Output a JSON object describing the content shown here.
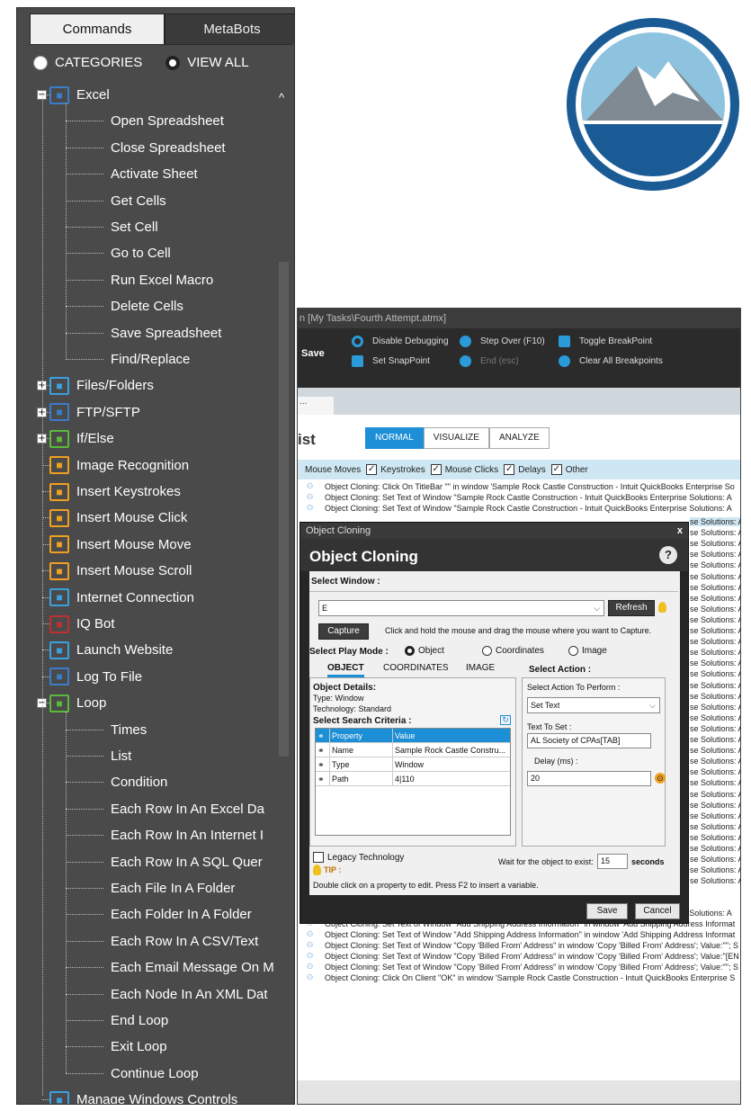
{
  "tabs": {
    "commands": "Commands",
    "metabots": "MetaBots"
  },
  "view": {
    "categories": "CATEGORIES",
    "view_all": "VIEW ALL",
    "selected": "view_all"
  },
  "tree": [
    {
      "label": "Excel",
      "icon": "excel-icon",
      "color": "#3a7dc9",
      "level": 0,
      "expander": "−"
    },
    {
      "label": "Open Spreadsheet",
      "level": 1
    },
    {
      "label": "Close Spreadsheet",
      "level": 1
    },
    {
      "label": "Activate Sheet",
      "level": 1
    },
    {
      "label": "Get Cells",
      "level": 1
    },
    {
      "label": "Set Cell",
      "level": 1
    },
    {
      "label": "Go to Cell",
      "level": 1
    },
    {
      "label": "Run Excel Macro",
      "level": 1
    },
    {
      "label": "Delete Cells",
      "level": 1
    },
    {
      "label": "Save Spreadsheet",
      "level": 1
    },
    {
      "label": "Find/Replace",
      "level": 1
    },
    {
      "label": "Files/Folders",
      "icon": "folder-icon",
      "color": "#3aa0e0",
      "level": 0,
      "expander": "+"
    },
    {
      "label": "FTP/SFTP",
      "icon": "ftp-icon",
      "color": "#3a7dc9",
      "level": 0,
      "expander": "+"
    },
    {
      "label": "If/Else",
      "icon": "if-else-icon",
      "color": "#5aba3a",
      "level": 0,
      "expander": "+"
    },
    {
      "label": "Image Recognition",
      "icon": "image-recognition-icon",
      "color": "#f0a020",
      "level": 0
    },
    {
      "label": "Insert Keystrokes",
      "icon": "keystrokes-icon",
      "color": "#f0a020",
      "level": 0
    },
    {
      "label": "Insert Mouse Click",
      "icon": "mouse-click-icon",
      "color": "#f0a020",
      "level": 0
    },
    {
      "label": "Insert Mouse Move",
      "icon": "mouse-move-icon",
      "color": "#f0a020",
      "level": 0
    },
    {
      "label": "Insert Mouse Scroll",
      "icon": "mouse-scroll-icon",
      "color": "#f0a020",
      "level": 0
    },
    {
      "label": "Internet Connection",
      "icon": "globe-icon",
      "color": "#3aa0e0",
      "level": 0
    },
    {
      "label": "IQ Bot",
      "icon": "iq-bot-icon",
      "color": "#c03030",
      "level": 0
    },
    {
      "label": "Launch Website",
      "icon": "launch-website-icon",
      "color": "#3aa0e0",
      "level": 0
    },
    {
      "label": "Log To File",
      "icon": "log-file-icon",
      "color": "#3a7dc9",
      "level": 0
    },
    {
      "label": "Loop",
      "icon": "loop-icon",
      "color": "#5aba3a",
      "level": 0,
      "expander": "−"
    },
    {
      "label": "Times",
      "level": 1
    },
    {
      "label": "List",
      "level": 1
    },
    {
      "label": "Condition",
      "level": 1
    },
    {
      "label": "Each Row In An Excel Da",
      "level": 1
    },
    {
      "label": "Each Row In An Internet I",
      "level": 1
    },
    {
      "label": "Each Row In A SQL Quer",
      "level": 1
    },
    {
      "label": "Each File In A Folder",
      "level": 1
    },
    {
      "label": "Each Folder In A Folder",
      "level": 1
    },
    {
      "label": "Each Row In A CSV/Text",
      "level": 1
    },
    {
      "label": "Each Email Message On M",
      "level": 1
    },
    {
      "label": "Each Node In An XML Dat",
      "level": 1
    },
    {
      "label": "End Loop",
      "level": 1
    },
    {
      "label": "Exit Loop",
      "level": 1
    },
    {
      "label": "Continue Loop",
      "level": 1
    },
    {
      "label": "Manage Windows Controls",
      "icon": "windows-controls-icon",
      "color": "#3aa0e0",
      "level": 0
    }
  ],
  "editor": {
    "window_title": "n [My Tasks\\Fourth Attempt.atmx]",
    "save": "Save",
    "toolbar": [
      {
        "label": "Disable Debugging",
        "icon": "debug-icon",
        "color": "#2a9ad8"
      },
      {
        "label": "Step Over (F10)",
        "icon": "step-over-icon",
        "color": "#2a9ad8"
      },
      {
        "label": "Toggle BreakPoint",
        "icon": "breakpoint-icon",
        "color": "#2a9ad8"
      },
      {
        "label": "Set SnapPoint",
        "icon": "snappoint-icon",
        "color": "#2a9ad8"
      },
      {
        "label": "End (esc)",
        "icon": "end-icon",
        "color": "#2a9ad8"
      },
      {
        "label": "Clear All Breakpoints",
        "icon": "clear-breakpoints-icon",
        "color": "#2a9ad8"
      }
    ],
    "tab": "...",
    "list_title": "ist",
    "views": [
      "NORMAL",
      "VISUALIZE",
      "ANALYZE"
    ],
    "filters": [
      "Mouse Moves",
      "Keystrokes",
      "Mouse Clicks",
      "Delays",
      "Other"
    ],
    "log_lines_top": [
      "Object Cloning: Click On TitleBar \"\" in window 'Sample Rock Castle Construction  - Intuit QuickBooks Enterprise So",
      "Object Cloning: Set Text of Window \"Sample Rock Castle Construction  - Intuit QuickBooks Enterprise Solutions: A",
      "Object Cloning: Set Text of Window \"Sample Rock Castle Construction  - Intuit QuickBooks Enterprise Solutions: A"
    ],
    "log_tail": "se Solutions: A",
    "log_lines_bottom": [
      "Object Cloning: Set Text of Window \"Sample Rock Castle Construction  - Intuit QuickBooks Enterprise Solutions: A",
      "Object Cloning: Set Text of Window \"Add Shipping Address Information\" in window 'Add Shipping Address Informat",
      "Object Cloning: Set Text of Window \"Add Shipping Address Information\" in window 'Add Shipping Address Informat",
      "Object Cloning: Set Text of Window \"Copy 'Billed From' Address\" in window 'Copy 'Billed From' Address'; Value:\"\"; S",
      "Object Cloning: Set Text of Window \"Copy 'Billed From' Address\" in window 'Copy 'Billed From' Address'; Value:\"[EN",
      "Object Cloning: Set Text of Window \"Copy 'Billed From' Address\" in window 'Copy 'Billed From' Address'; Value:\"\"; S",
      "Object Cloning: Click On Client \"OK\" in window 'Sample Rock Castle Construction  - Intuit QuickBooks Enterprise S"
    ]
  },
  "dialog": {
    "title_bar": "Object Cloning",
    "close": "x",
    "heading": "Object Cloning",
    "help": "?",
    "select_window_label": "Select Window :",
    "window_value": "E",
    "refresh": "Refresh",
    "capture": "Capture",
    "capture_hint": "Click and hold the mouse and drag the mouse where you want to Capture.",
    "play_mode_label": "Select Play Mode :",
    "play_modes": [
      "Object",
      "Coordinates",
      "Image"
    ],
    "subtabs": [
      "OBJECT",
      "COORDINATES",
      "IMAGE"
    ],
    "select_action_label": "Select Action :",
    "object_details": "Object Details:",
    "type_line": "Type:  Window",
    "technology_line": "Technology:  Standard",
    "search_criteria": "Select Search Criteria :",
    "grid_headers": [
      "Property",
      "Value"
    ],
    "grid_rows": [
      [
        "Name",
        "Sample Rock Castle Constru..."
      ],
      [
        "Type",
        "Window"
      ],
      [
        "Path",
        "4|110"
      ]
    ],
    "action_perform_label": "Select Action To Perform :",
    "action_value": "Set Text",
    "text_to_set_label": "Text To Set :",
    "text_to_set_value": "AL Society of CPAs[TAB]",
    "delay_label": "Delay  (ms) :",
    "delay_value": "20",
    "legacy": "Legacy Technology",
    "wait_label": "Wait for the object to exist:",
    "wait_value": "15",
    "seconds": "seconds",
    "tip": "TIP :",
    "tip_text": "Double click on a property to edit. Press F2 to insert a variable.",
    "save": "Save",
    "cancel": "Cancel"
  }
}
